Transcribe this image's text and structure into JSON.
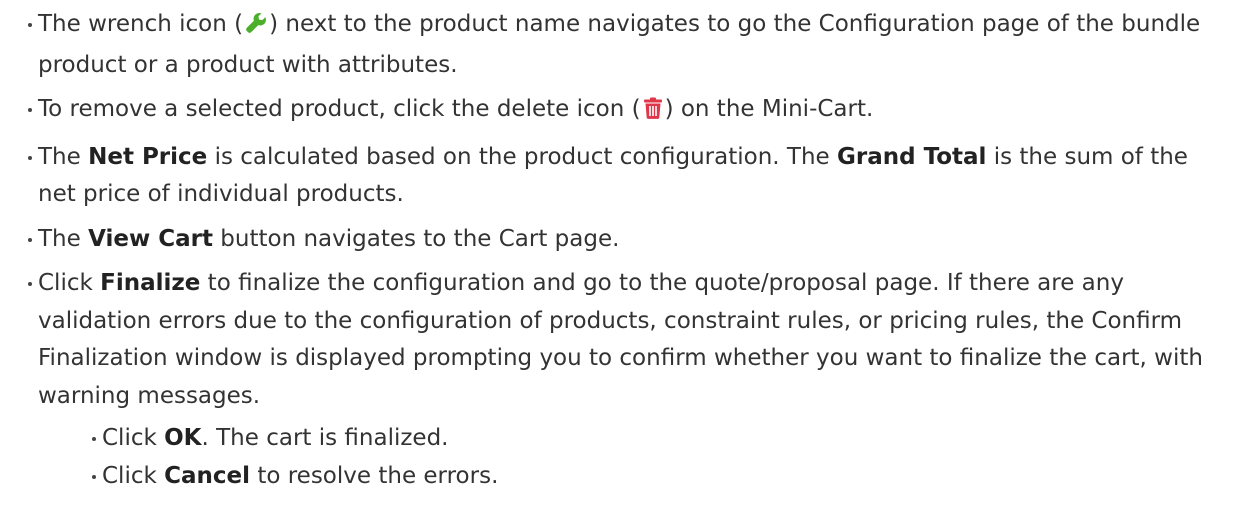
{
  "icons": {
    "wrench": {
      "name": "wrench-icon",
      "color": "#4caf2a"
    },
    "delete": {
      "name": "trash-icon",
      "color": "#e0364a"
    }
  },
  "items": [
    {
      "a": "The wrench icon (",
      "b": ") next to the product name navigates to go the Configuration page of the bundle product or a product with attributes."
    },
    {
      "a": "To remove a selected product, click the delete icon (",
      "b": ") on the Mini-Cart."
    },
    {
      "a": "The ",
      "b1": "Net Price",
      "c": " is calculated based on the product configuration. The ",
      "b2": "Grand Total",
      "d": " is the sum of the net price of individual products."
    },
    {
      "a": "The ",
      "b1": "View Cart",
      "c": " button navigates to the Cart page."
    },
    {
      "a": "Click ",
      "b1": "Finalize",
      "c": " to finalize the configuration and go to the quote/proposal page. If there are any validation errors due to the configuration of products, constraint rules, or pricing rules, the Confirm Finalization window is displayed prompting you to confirm whether you want to finalize the cart, with warning messages.",
      "sub": [
        {
          "a": "Click ",
          "b1": "OK",
          "c": ". The cart is finalized."
        },
        {
          "a": "Click ",
          "b1": "Cancel",
          "c": " to resolve the errors."
        }
      ]
    }
  ]
}
